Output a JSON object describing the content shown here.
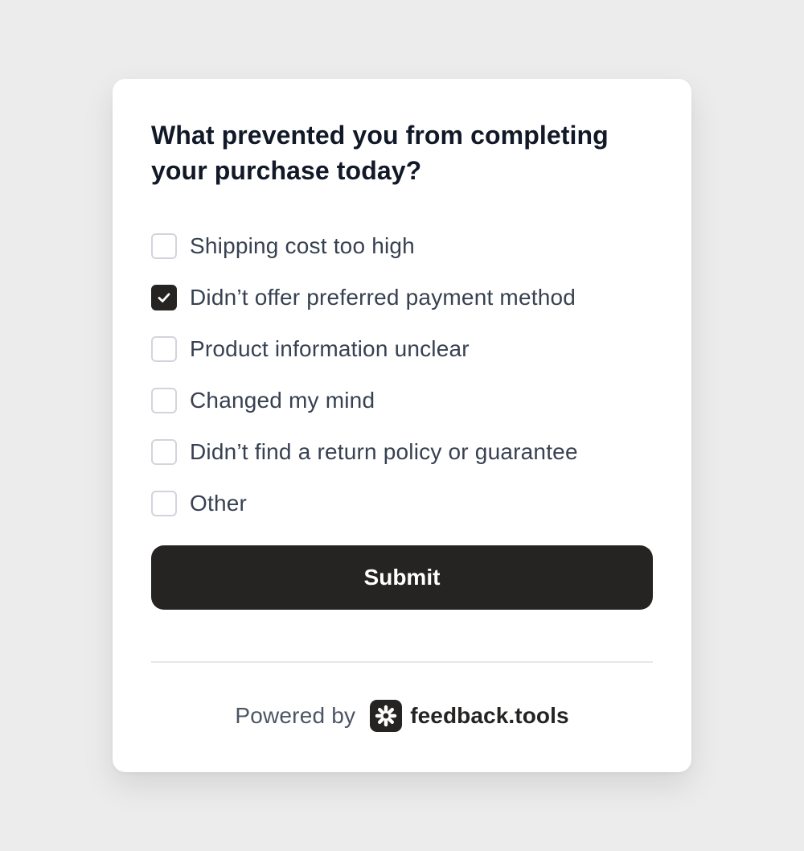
{
  "survey": {
    "question": "What prevented you from completing your purchase today?",
    "options": [
      {
        "label": "Shipping cost too high",
        "checked": false
      },
      {
        "label": "Didn’t offer preferred payment method",
        "checked": true
      },
      {
        "label": "Product information unclear",
        "checked": false
      },
      {
        "label": "Changed my mind",
        "checked": false
      },
      {
        "label": "Didn’t find a return policy or guarantee",
        "checked": false
      },
      {
        "label": "Other",
        "checked": false
      }
    ],
    "submit_label": "Submit"
  },
  "footer": {
    "powered_by": "Powered by",
    "brand_name": "feedback.tools",
    "brand_icon": "asterisk-logo-icon"
  },
  "colors": {
    "page_background": "#ececec",
    "card_background": "#ffffff",
    "accent_dark": "#252422",
    "heading_text": "#111827",
    "option_text": "#374151",
    "checkbox_border": "#d1d5db"
  }
}
